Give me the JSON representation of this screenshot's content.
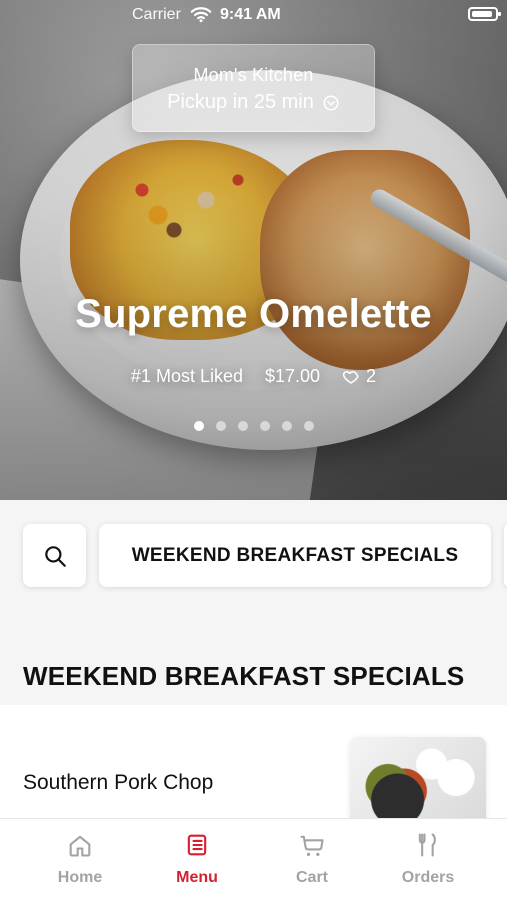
{
  "status_bar": {
    "carrier": "Carrier",
    "time": "9:41 AM"
  },
  "pickup": {
    "store_name": "Mom's Kitchen",
    "pickup_text": "Pickup in 25 min"
  },
  "hero": {
    "title": "Supreme Omelette",
    "rank_text": "#1 Most Liked",
    "price": "$17.00",
    "likes": "2",
    "dots": {
      "count": 6,
      "active_index": 0
    }
  },
  "filters": {
    "search_icon": "search-icon",
    "selected_category": "WEEKEND BREAKFAST SPECIALS"
  },
  "section": {
    "title": "WEEKEND BREAKFAST SPECIALS"
  },
  "menu_items": [
    {
      "name": "Southern Pork Chop"
    }
  ],
  "tabbar": {
    "tabs": [
      {
        "label": "Home",
        "icon": "home-icon",
        "active": false
      },
      {
        "label": "Menu",
        "icon": "menu-icon",
        "active": true
      },
      {
        "label": "Cart",
        "icon": "cart-icon",
        "active": false
      },
      {
        "label": "Orders",
        "icon": "orders-icon",
        "active": false
      }
    ]
  },
  "colors": {
    "accent": "#d61f2c",
    "inactive": "#a3a3a3",
    "background": "#f5f5f5"
  }
}
